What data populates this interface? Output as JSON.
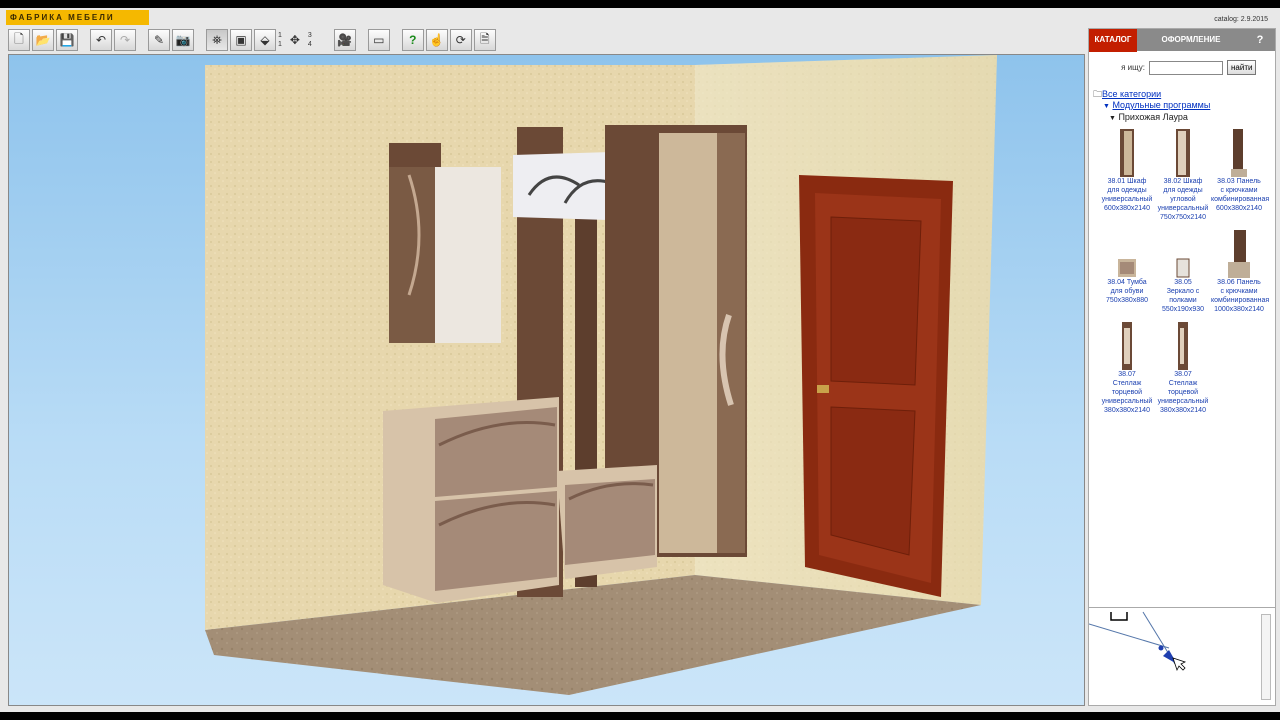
{
  "app": {
    "logo_text": "ФАБРИКА МЕБЕЛИ",
    "catalog_date": "catalog: 2.9.2015"
  },
  "toolbar": {
    "buttons": [
      "new-doc-icon",
      "open-folder-icon",
      "save-icon",
      "undo-icon",
      "redo-icon",
      "edit-icon",
      "camera-icon",
      "view-front-icon",
      "view-top-icon",
      "view-3d-icon",
      "move-camera-icon",
      "wall-view-icon",
      "help-icon",
      "hand-icon",
      "rotate-icon",
      "page-icon"
    ],
    "view_numbers": [
      "1",
      "1",
      "2",
      "3",
      "4"
    ]
  },
  "panel": {
    "tabs": {
      "catalog": "КАТАЛОГ",
      "design": "ОФОРМЛЕНИЕ",
      "help": "?"
    },
    "search": {
      "label": "я ищу:",
      "value": "",
      "button": "найти"
    },
    "tree": {
      "all": "Все категории",
      "modular": "Модульные программы",
      "collection": "Прихожая Лаура"
    },
    "items": [
      {
        "lines": [
          "38.01 Шкаф",
          "для одежды",
          "универсальный",
          "600x380x2140"
        ],
        "icon": "wardrobe-icon"
      },
      {
        "lines": [
          "38.02 Шкаф",
          "для одежды",
          "угловой",
          "универсальный",
          "750x750x2140"
        ],
        "icon": "wardrobe-icon"
      },
      {
        "lines": [
          "38.03 Панель",
          "с крючками",
          "комбинированная",
          "600x380x2140"
        ],
        "icon": "hanger-panel-icon"
      },
      {
        "lines": [
          "38.04 Тумба",
          "для обуви",
          "750x380x880"
        ],
        "icon": "shoe-cabinet-icon"
      },
      {
        "lines": [
          "38.05",
          "Зеркало с",
          "полками",
          "550x190x930"
        ],
        "icon": "mirror-icon"
      },
      {
        "lines": [
          "38.06 Панель",
          "с крючками",
          "комбинированная",
          "1000x380x2140"
        ],
        "icon": "hanger-panel-icon"
      },
      {
        "lines": [
          "38.07",
          "Стеллаж",
          "торцевой",
          "универсальный",
          "380x380x2140"
        ],
        "icon": "shelf-icon"
      },
      {
        "lines": [
          "38.07",
          "Стеллаж",
          "торцевой",
          "универсальный",
          "380x380x2140"
        ],
        "icon": "shelf-icon"
      }
    ]
  },
  "colors": {
    "accent": "#c31e00",
    "logo_bg": "#f5b800",
    "link": "#0030c0"
  }
}
